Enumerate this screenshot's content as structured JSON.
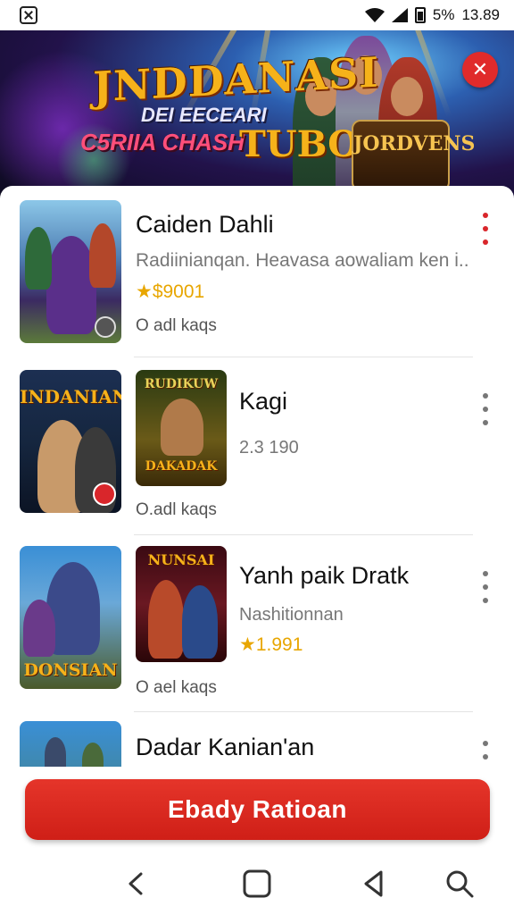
{
  "status_bar": {
    "signal_text": "5%",
    "time": "13.89"
  },
  "banner": {
    "title": "JNDDANASI",
    "subtitle": "DEI EECEARI",
    "tag_left": "C5RIIA CHASH",
    "tag_center": "TUBOEN",
    "tag_right": "JORDVENS"
  },
  "items": [
    {
      "title": "Caiden Dahli",
      "description": "Radiinianqan. Heavasa aowaliam ken i..",
      "price": "★$9001",
      "meta": "O adl kaqs"
    },
    {
      "thumb_label": "INDANIAN",
      "thumb2_label_top": "RUDIKUW",
      "thumb2_label_bottom": "DAKADAK",
      "title": "Kagi",
      "description": "2.3 190",
      "meta": "O.adl kaqs"
    },
    {
      "thumb_label": "DONSIAN",
      "thumb2_label_top": "NUNSAI",
      "title": "Yanh paik Dratk",
      "description": "Nashitionnan",
      "price": "★1.991",
      "meta": "O ael kaqs"
    },
    {
      "title": "Dadar Kanian'an"
    }
  ],
  "cta": {
    "label": "Ebady Ratioan"
  },
  "colors": {
    "accent": "#d9262b",
    "star": "#e8a600"
  },
  "icons": {
    "status_app": "app-notification-icon",
    "back": "back-chevron-icon",
    "home": "home-square-icon",
    "recents": "recents-triangle-icon",
    "search": "search-icon"
  }
}
